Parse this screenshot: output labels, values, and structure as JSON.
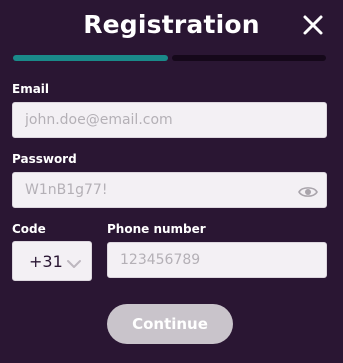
{
  "header": {
    "title": "Registration",
    "close_icon": "close-icon"
  },
  "progress": {
    "fraction": 0.5,
    "fill_color": "#1a8a8a",
    "track_color": "#15081a"
  },
  "form": {
    "email": {
      "label": "Email",
      "value": "",
      "placeholder": "john.doe@email.com"
    },
    "password": {
      "label": "Password",
      "value": "",
      "placeholder": "W1nB1g77!",
      "toggle_icon": "eye-icon"
    },
    "code": {
      "label": "Code",
      "selected": "+31",
      "icon": "chevron-down-icon"
    },
    "phone": {
      "label": "Phone number",
      "value": "",
      "placeholder": "123456789"
    }
  },
  "actions": {
    "continue_label": "Continue"
  },
  "colors": {
    "background": "#2a1633",
    "input_background": "#f3f0f4",
    "button_disabled": "#c9c4cb"
  }
}
